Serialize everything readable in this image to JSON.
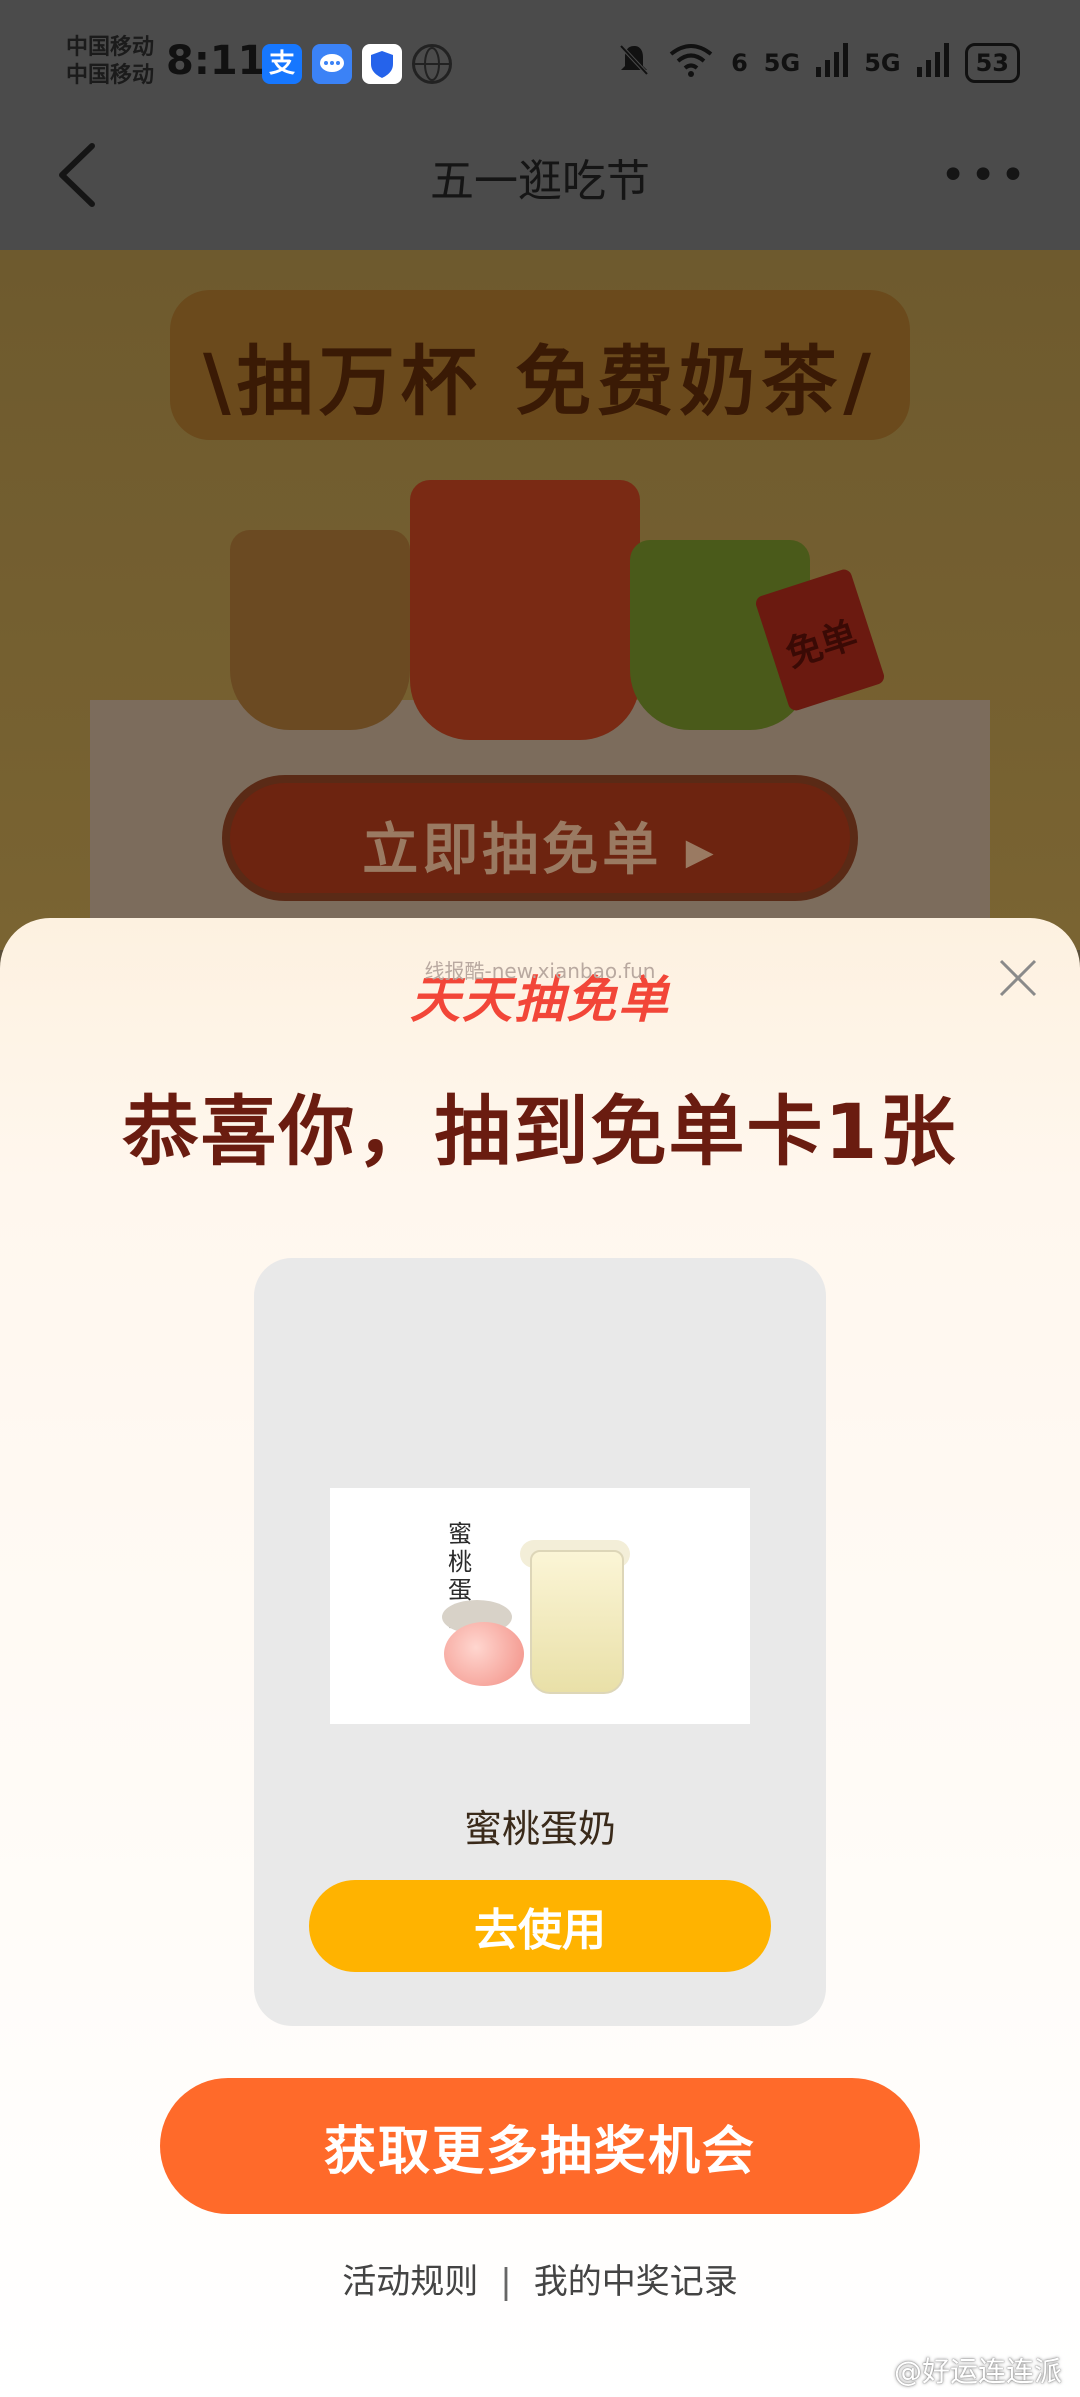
{
  "status_bar": {
    "carrier_1": "中国移动",
    "carrier_2": "中国移动",
    "time": "8:11",
    "alipay_glyph": "支",
    "signal_1": "5G",
    "signal_2": "5G",
    "wifi_badge": "6",
    "battery": "53"
  },
  "nav": {
    "title": "五一逛吃节",
    "more": "•••"
  },
  "hero": {
    "title": "\\抽万杯 免费奶茶/",
    "ticket_text": "免单",
    "button_label": "立即抽免单 ▸"
  },
  "modal": {
    "brand": "天天抽免单",
    "watermark": "线报酷-new.xianbao.fun",
    "headline": "恭喜你，抽到免单卡1张",
    "product": {
      "image_caption": "蜜桃蛋奶",
      "name": "蜜桃蛋奶",
      "use_button": "去使用"
    },
    "more_button": "获取更多抽奖机会",
    "links": {
      "rules": "活动规则",
      "separator": "|",
      "records": "我的中奖记录"
    }
  },
  "overlay": {
    "weibo_watermark": "@好运连连派"
  },
  "colors": {
    "accent_orange": "#ff6a2a",
    "use_button_yellow": "#ffb300",
    "headline_brown": "#6a1c10",
    "brand_red": "#f24638"
  }
}
